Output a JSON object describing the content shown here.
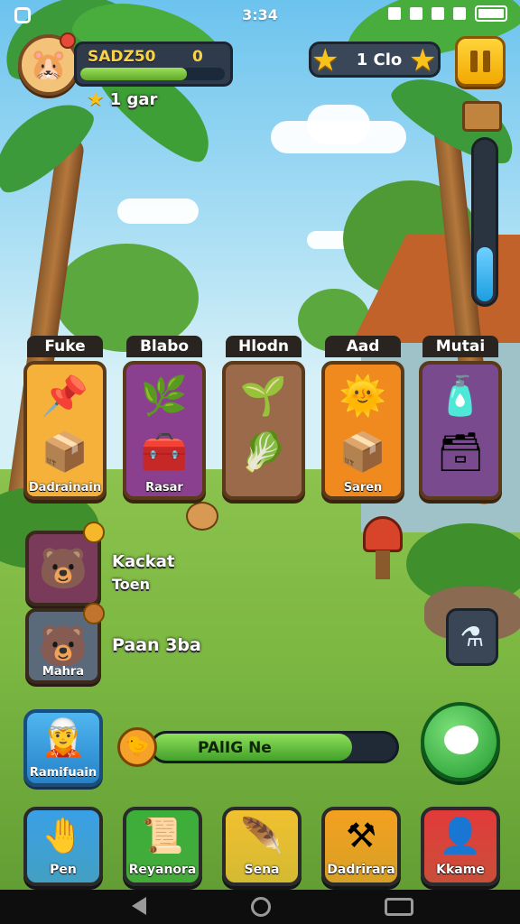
{
  "status_bar": {
    "time": "3:34"
  },
  "player": {
    "name": "SADZ50",
    "score": "0",
    "level_label": "1 gar",
    "xp_progress": 0.74
  },
  "currency": {
    "amount": "1 Clo"
  },
  "side_meter": {
    "fill_fraction": 0.33
  },
  "categories": [
    {
      "title": "Fuke",
      "label": "Dadrainain",
      "top_icon": "map-pin-icon",
      "bottom_icon": "crate-icon",
      "color": "#f5b13a"
    },
    {
      "title": "Blabo",
      "label": "Rasar",
      "top_icon": "leaf-icon",
      "bottom_icon": "chest-icon",
      "color": "#8a3f8f"
    },
    {
      "title": "Hlodn",
      "label": "",
      "top_icon": "herb-icon",
      "bottom_icon": "bundle-icon",
      "color": "#9a6a4a"
    },
    {
      "title": "Aad",
      "label": "Saren",
      "top_icon": "sun-face-icon",
      "bottom_icon": "crate-icon",
      "color": "#f08a1e"
    },
    {
      "title": "Mutai",
      "label": "",
      "top_icon": "jar-icon",
      "bottom_icon": "box-icon",
      "color": "#7a4a8e"
    }
  ],
  "quests": [
    {
      "title_line1": "Kackat",
      "title_line2": "Toen",
      "sublabel": "",
      "icon": "bear-icon",
      "color": "#7a3a5a"
    },
    {
      "title_line1": "Paan 3ba",
      "title_line2": "",
      "sublabel": "Mahra",
      "icon": "bear-face-icon",
      "color": "#5a6a7a"
    }
  ],
  "helper": {
    "label": "Ramifuain",
    "icon": "elf-icon"
  },
  "progress": {
    "label": "PAlIG Ne",
    "fraction": 0.82
  },
  "nav": [
    {
      "label": "Pen",
      "icon": "hand-icon",
      "color": "#3aa0e6"
    },
    {
      "label": "Reyanora",
      "icon": "scroll-icon",
      "color": "#3cae3a"
    },
    {
      "label": "Sena",
      "icon": "feather-icon",
      "color": "#f0c030"
    },
    {
      "label": "Dadrirara",
      "icon": "crossed-tools-icon",
      "color": "#f4a020"
    },
    {
      "label": "Kkame",
      "icon": "person-icon",
      "color": "#e23a3a"
    }
  ],
  "colors": {
    "accent_green": "#42a02a",
    "accent_gold": "#f8c21a",
    "panel_dark": "#2f3b4b"
  }
}
